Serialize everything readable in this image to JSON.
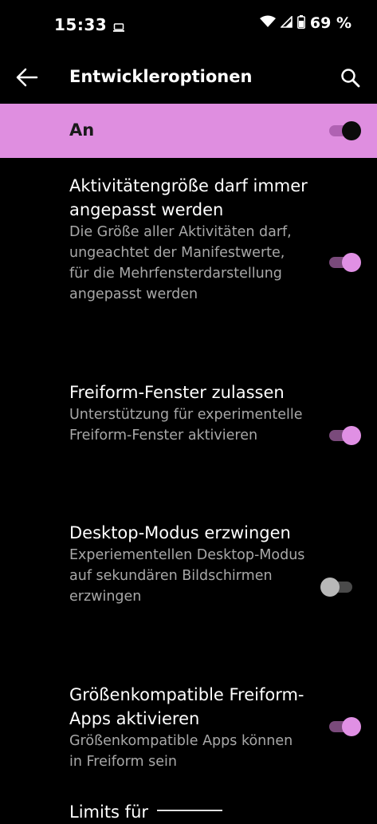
{
  "status_bar": {
    "time": "15:33",
    "battery": "69 %",
    "icons": [
      "cast-icon",
      "wifi-icon",
      "signal-icon",
      "battery-icon"
    ]
  },
  "app_bar": {
    "title": "Entwickleroptionen",
    "icons": [
      "back-arrow-icon",
      "search-icon"
    ]
  },
  "master": {
    "label": "An",
    "enabled": true,
    "color": "#df8ee0"
  },
  "settings": [
    {
      "title": "Aktivitätengröße darf immer angepasst werden",
      "summary": "Die Größe aller Aktivitäten darf, ungeachtet der Manifestwerte, für die Mehrfensterdarstellung angepasst werden",
      "enabled": true
    },
    {
      "title": "Freiform-Fenster zulassen",
      "summary": "Unterstützung für experimentelle Freiform-Fenster aktivieren",
      "enabled": true
    },
    {
      "title": "Desktop-Modus erzwingen",
      "summary": "Experiementellen Desktop-Modus auf sekundären Bildschirmen erzwingen",
      "enabled": false
    },
    {
      "title": "Größenkompatible Freiform-Apps aktivieren",
      "summary": "Größenkompatible Apps können in Freiform sein",
      "enabled": true
    },
    {
      "title": "Limits für",
      "summary": "",
      "enabled": null
    }
  ],
  "colors": {
    "accent": "#e090e4",
    "background": "#000000",
    "summary_text": "#a8a8a8"
  }
}
